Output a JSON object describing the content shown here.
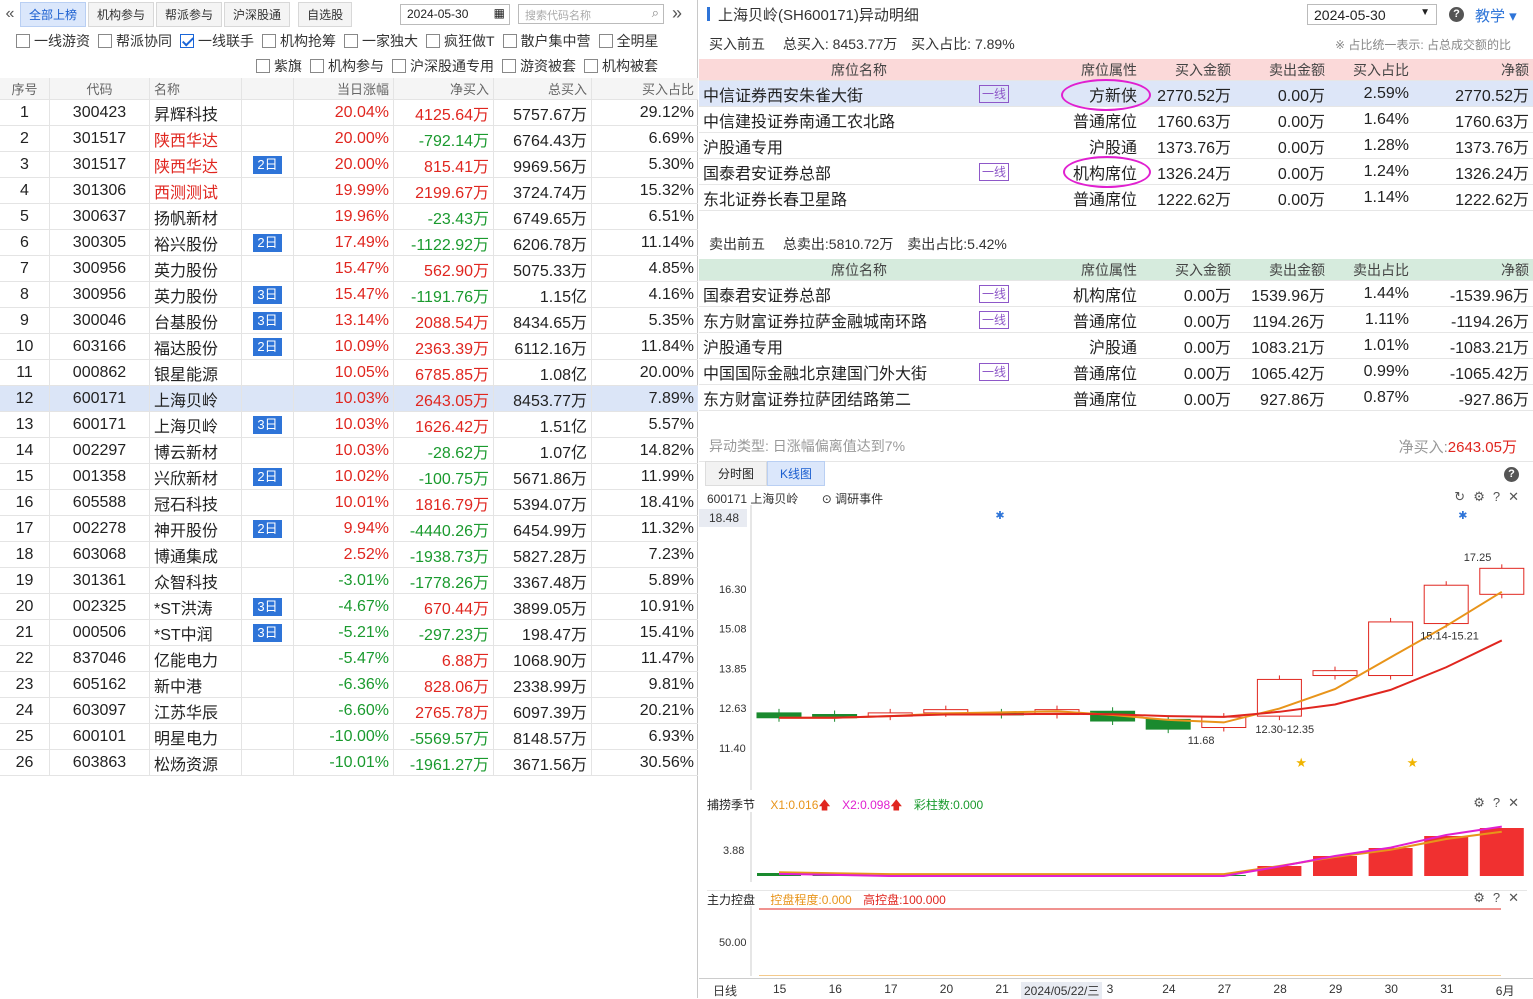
{
  "left": {
    "tabs": [
      "全部上榜",
      "机构参与",
      "帮派参与",
      "沪深股通",
      "自选股"
    ],
    "date": "2024-05-30",
    "search_placeholder": "搜索代码名称",
    "filters1": [
      {
        "label": "一线游资",
        "on": false
      },
      {
        "label": "帮派协同",
        "on": false
      },
      {
        "label": "一线联手",
        "on": true
      },
      {
        "label": "机构抢筹",
        "on": false
      },
      {
        "label": "一家独大",
        "on": false
      },
      {
        "label": "疯狂做T",
        "on": false
      },
      {
        "label": "散户集中营",
        "on": false
      },
      {
        "label": "全明星",
        "on": false
      }
    ],
    "filters2": [
      {
        "label": "紫旗",
        "on": false
      },
      {
        "label": "机构参与",
        "on": false
      },
      {
        "label": "沪深股通专用",
        "on": false
      },
      {
        "label": "游资被套",
        "on": false
      },
      {
        "label": "机构被套",
        "on": false
      }
    ],
    "headers": [
      "序号",
      "代码",
      "名称",
      "",
      "当日涨幅",
      "净买入",
      "总买入",
      "买入占比"
    ],
    "rows": [
      [
        "1",
        "300423",
        "昇辉科技",
        "",
        "20.04%",
        "4125.64万",
        "5757.67万",
        "29.12%"
      ],
      [
        "2",
        "301517",
        "陕西华达",
        "",
        "20.00%",
        "-792.14万",
        "6764.43万",
        "6.69%"
      ],
      [
        "3",
        "301517",
        "陕西华达",
        "2日",
        "20.00%",
        "815.41万",
        "9969.56万",
        "5.30%"
      ],
      [
        "4",
        "301306",
        "西测测试",
        "",
        "19.99%",
        "2199.67万",
        "3724.74万",
        "15.32%"
      ],
      [
        "5",
        "300637",
        "扬帆新材",
        "",
        "19.96%",
        "-23.43万",
        "6749.65万",
        "6.51%"
      ],
      [
        "6",
        "300305",
        "裕兴股份",
        "2日",
        "17.49%",
        "-1122.92万",
        "6206.78万",
        "11.14%"
      ],
      [
        "7",
        "300956",
        "英力股份",
        "",
        "15.47%",
        "562.90万",
        "5075.33万",
        "4.85%"
      ],
      [
        "8",
        "300956",
        "英力股份",
        "3日",
        "15.47%",
        "-1191.76万",
        "1.15亿",
        "4.16%"
      ],
      [
        "9",
        "300046",
        "台基股份",
        "3日",
        "13.14%",
        "2088.54万",
        "8434.65万",
        "5.35%"
      ],
      [
        "10",
        "603166",
        "福达股份",
        "2日",
        "10.09%",
        "2363.39万",
        "6112.16万",
        "11.84%"
      ],
      [
        "11",
        "000862",
        "银星能源",
        "",
        "10.05%",
        "6785.85万",
        "1.08亿",
        "20.00%"
      ],
      [
        "12",
        "600171",
        "上海贝岭",
        "",
        "10.03%",
        "2643.05万",
        "8453.77万",
        "7.89%"
      ],
      [
        "13",
        "600171",
        "上海贝岭",
        "3日",
        "10.03%",
        "1626.42万",
        "1.51亿",
        "5.57%"
      ],
      [
        "14",
        "002297",
        "博云新材",
        "",
        "10.03%",
        "-28.62万",
        "1.07亿",
        "14.82%"
      ],
      [
        "15",
        "001358",
        "兴欣新材",
        "2日",
        "10.02%",
        "-100.75万",
        "5671.86万",
        "11.99%"
      ],
      [
        "16",
        "605588",
        "冠石科技",
        "",
        "10.01%",
        "1816.79万",
        "5394.07万",
        "18.41%"
      ],
      [
        "17",
        "002278",
        "神开股份",
        "2日",
        "9.94%",
        "-4440.26万",
        "6454.99万",
        "11.32%"
      ],
      [
        "18",
        "603068",
        "博通集成",
        "",
        "2.52%",
        "-1938.73万",
        "5827.28万",
        "7.23%"
      ],
      [
        "19",
        "301361",
        "众智科技",
        "",
        "-3.01%",
        "-1778.26万",
        "3367.48万",
        "5.89%"
      ],
      [
        "20",
        "002325",
        "*ST洪涛",
        "3日",
        "-4.67%",
        "670.44万",
        "3899.05万",
        "10.91%"
      ],
      [
        "21",
        "000506",
        "*ST中润",
        "3日",
        "-5.21%",
        "-297.23万",
        "198.47万",
        "15.41%"
      ],
      [
        "22",
        "837046",
        "亿能电力",
        "",
        "-5.47%",
        "6.88万",
        "1068.90万",
        "11.47%"
      ],
      [
        "23",
        "605162",
        "新中港",
        "",
        "-6.36%",
        "828.06万",
        "2338.99万",
        "9.81%"
      ],
      [
        "24",
        "603097",
        "江苏华辰",
        "",
        "-6.60%",
        "2765.78万",
        "6097.39万",
        "20.21%"
      ],
      [
        "25",
        "600101",
        "明星电力",
        "",
        "-10.00%",
        "-5569.57万",
        "8148.57万",
        "6.93%"
      ],
      [
        "26",
        "603863",
        "松炀资源",
        "",
        "-10.01%",
        "-1961.27万",
        "3671.56万",
        "30.56%"
      ]
    ],
    "red_names": [
      "2",
      "3",
      "4"
    ],
    "selected_row": "12"
  },
  "right": {
    "title": "上海贝岭(SH600171)异动明细",
    "date": "2024-05-30",
    "help_label": "教学",
    "buy": {
      "label": "买入前五",
      "total": "总买入: 8453.77万",
      "ratio": "买入占比: 7.89%",
      "note": "※ 占比统一表示: 占总成交额的比"
    },
    "buy_headers": [
      "席位名称",
      "席位属性",
      "买入金额",
      "卖出金额",
      "买入占比",
      "净额"
    ],
    "buy_rows": [
      [
        "中信证券西安朱雀大街",
        "一线",
        "方新侠",
        "2770.52万",
        "0.00万",
        "2.59%",
        "2770.52万"
      ],
      [
        "中信建投证券南通工农北路",
        "",
        "普通席位",
        "1760.63万",
        "0.00万",
        "1.64%",
        "1760.63万"
      ],
      [
        "沪股通专用",
        "",
        "沪股通",
        "1373.76万",
        "0.00万",
        "1.28%",
        "1373.76万"
      ],
      [
        "国泰君安证券总部",
        "一线",
        "机构席位",
        "1326.24万",
        "0.00万",
        "1.24%",
        "1326.24万"
      ],
      [
        "东北证券长春卫星路",
        "",
        "普通席位",
        "1222.62万",
        "0.00万",
        "1.14%",
        "1222.62万"
      ]
    ],
    "sell": {
      "label": "卖出前五",
      "total": "总卖出:5810.72万",
      "ratio": "卖出占比:5.42%"
    },
    "sell_headers": [
      "席位名称",
      "席位属性",
      "买入金额",
      "卖出金额",
      "卖出占比",
      "净额"
    ],
    "sell_rows": [
      [
        "国泰君安证券总部",
        "一线",
        "机构席位",
        "0.00万",
        "1539.96万",
        "1.44%",
        "-1539.96万"
      ],
      [
        "东方财富证券拉萨金融城南环路",
        "一线",
        "普通席位",
        "0.00万",
        "1194.26万",
        "1.11%",
        "-1194.26万"
      ],
      [
        "沪股通专用",
        "",
        "沪股通",
        "0.00万",
        "1083.21万",
        "1.01%",
        "-1083.21万"
      ],
      [
        "中国国际金融北京建国门外大街",
        "一线",
        "普通席位",
        "0.00万",
        "1065.42万",
        "0.99%",
        "-1065.42万"
      ],
      [
        "东方财富证券拉萨团结路第二",
        "",
        "普通席位",
        "0.00万",
        "927.86万",
        "0.87%",
        "-927.86万"
      ]
    ],
    "anomaly": "异动类型: 日涨幅偏离值达到7%",
    "net_label": "净买入:",
    "net_value": "2643.05万",
    "chart_tabs": [
      "分时图",
      "K线图"
    ],
    "chart_stock": "600171 上海贝岭",
    "chart_event": "调研事件",
    "ind1": {
      "name": "捕捞季节",
      "x1": "X1:0.016",
      "x2": "X2:0.098",
      "c": "彩柱数:0.000",
      "tick": "3.88"
    },
    "ind2": {
      "name": "主力控盘",
      "a": "控盘程度:0.000",
      "b": "高控盘:100.000",
      "tick": "50.00"
    },
    "x_axis": {
      "first": "日线",
      "labels": [
        "15",
        "16",
        "17",
        "20",
        "21",
        "2024/05/22/三",
        "3",
        "24",
        "27",
        "28",
        "29",
        "30",
        "31",
        "6月"
      ]
    }
  },
  "chart_data": {
    "type": "candlestick",
    "y_ticks": [
      18.48,
      16.3,
      15.08,
      13.85,
      12.63,
      11.4
    ],
    "candles": [
      {
        "o": 12.45,
        "c": 12.3
      },
      {
        "o": 12.4,
        "c": 12.3
      },
      {
        "o": 12.35,
        "c": 12.45
      },
      {
        "o": 12.45,
        "c": 12.55
      },
      {
        "o": 12.45,
        "c": 12.4
      },
      {
        "o": 12.4,
        "c": 12.55
      },
      {
        "o": 12.5,
        "c": 12.2
      },
      {
        "o": 12.25,
        "c": 11.95
      },
      {
        "o": 12.0,
        "c": 12.32
      },
      {
        "o": 12.35,
        "c": 13.48
      },
      {
        "o": 13.6,
        "c": 13.75
      },
      {
        "o": 13.6,
        "c": 15.25
      },
      {
        "o": 15.2,
        "c": 16.38
      },
      {
        "o": 16.1,
        "c": 16.9
      }
    ],
    "annotations": [
      "17.25",
      "15.14-15.21",
      "12.30-12.35",
      "11.68"
    ]
  }
}
